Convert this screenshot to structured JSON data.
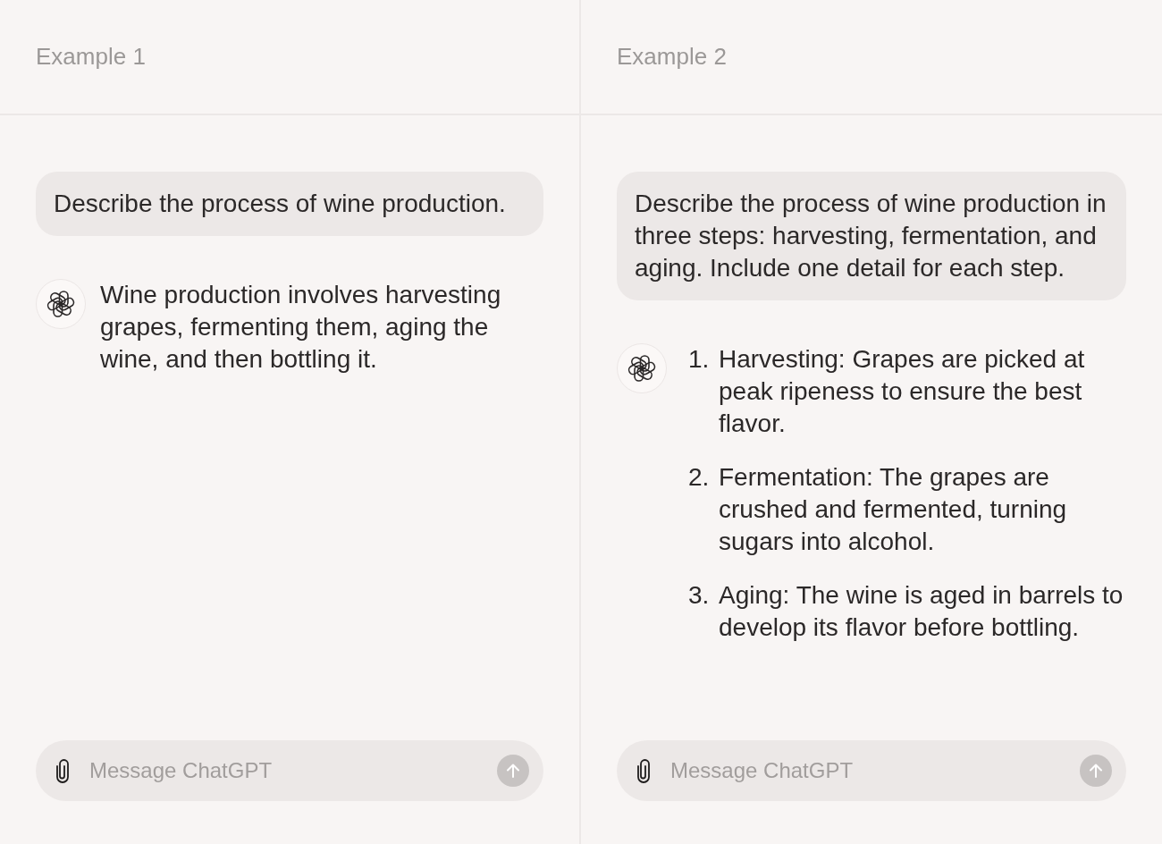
{
  "panels": [
    {
      "title": "Example 1",
      "messages": [
        {
          "kind": "user",
          "text": "Describe the process of wine production."
        },
        {
          "kind": "assistant",
          "text": "Wine production involves harvesting grapes, fermenting them, aging the wine, and then bottling it."
        }
      ],
      "composer": {
        "placeholder": "Message ChatGPT",
        "send_disabled": true
      }
    },
    {
      "title": "Example 2",
      "messages": [
        {
          "kind": "user",
          "text": "Describe the process of wine production in three steps: harvesting, fermentation, and aging. Include one detail for each step."
        },
        {
          "kind": "assistant",
          "items": [
            {
              "number": "1.",
              "text": "Harvesting: Grapes are picked at peak ripeness to ensure the best flavor."
            },
            {
              "number": "2.",
              "text": "Fermentation: The grapes are crushed and fermented, turning sugars into alcohol."
            },
            {
              "number": "3.",
              "text": "Aging: The wine is aged in barrels to develop its flavor before bottling."
            }
          ]
        }
      ],
      "composer": {
        "placeholder": "Message ChatGPT",
        "send_disabled": true
      }
    }
  ]
}
